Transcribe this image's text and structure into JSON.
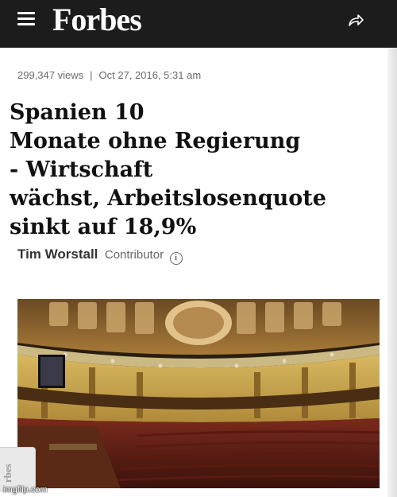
{
  "header": {
    "logo_text": "Forbes",
    "menu_icon": "hamburger-menu-icon",
    "share_icon": "share-arrow-icon",
    "background": "#1c1c1c"
  },
  "article": {
    "views": "299,347 views",
    "separator": "|",
    "date": "Oct 27, 2016, 5:31 am",
    "headline": "Spanien 10\nMonate ohne Regierung\n- Wirtschaft\nwächst, Arbeitslosenquote\nsinkt auf 18,9%",
    "author": "Tim Worstall",
    "author_role": "Contributor",
    "info_icon": "info-circle-icon",
    "info_glyph": "i"
  },
  "side_tab": {
    "text": "rbes"
  },
  "watermark": "imgflip.com"
}
